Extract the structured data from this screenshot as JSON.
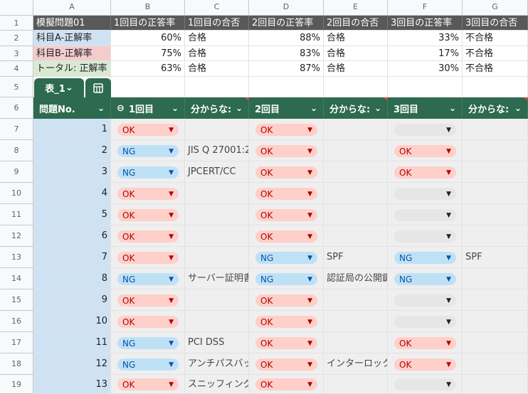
{
  "column_letters": [
    "A",
    "B",
    "C",
    "D",
    "E",
    "F",
    "G"
  ],
  "row_numbers": [
    "1",
    "2",
    "3",
    "4",
    "5",
    "6",
    "7",
    "8",
    "9",
    "10",
    "11",
    "12",
    "13",
    "14",
    "15",
    "16",
    "17",
    "18",
    "19"
  ],
  "summary": {
    "header": [
      "模擬問題01",
      "1回目の正答率",
      "1回目の合否",
      "2回目の正答率",
      "2回目の合否",
      "3回目の正答率",
      "3回目の合否"
    ],
    "rows": [
      [
        "科目A-正解率",
        "60%",
        "合格",
        "88%",
        "合格",
        "33%",
        "不合格"
      ],
      [
        "科目B-正解率",
        "75%",
        "合格",
        "83%",
        "合格",
        "17%",
        "不合格"
      ],
      [
        "トータル: 正解率",
        "63%",
        "合格",
        "87%",
        "合格",
        "30%",
        "不合格"
      ]
    ]
  },
  "table": {
    "tab_name": "表_1",
    "view_icon": "table-view-icon",
    "columns": [
      "問題No.",
      "1回目",
      "分からな:",
      "2回目",
      "分からな:",
      "3回目",
      "分からな:"
    ],
    "rows": [
      {
        "no": "1",
        "r1": "OK",
        "n1": "",
        "r2": "OK",
        "n2": "",
        "r3": "",
        "n3": ""
      },
      {
        "no": "2",
        "r1": "NG",
        "n1": "JIS Q 27001:2",
        "r2": "OK",
        "n2": "",
        "r3": "OK",
        "n3": ""
      },
      {
        "no": "3",
        "r1": "NG",
        "n1": "JPCERT/CC",
        "r2": "OK",
        "n2": "",
        "r3": "OK",
        "n3": ""
      },
      {
        "no": "4",
        "r1": "OK",
        "n1": "",
        "r2": "OK",
        "n2": "",
        "r3": "",
        "n3": ""
      },
      {
        "no": "5",
        "r1": "OK",
        "n1": "",
        "r2": "OK",
        "n2": "",
        "r3": "",
        "n3": ""
      },
      {
        "no": "6",
        "r1": "OK",
        "n1": "",
        "r2": "OK",
        "n2": "",
        "r3": "",
        "n3": ""
      },
      {
        "no": "7",
        "r1": "OK",
        "n1": "",
        "r2": "NG",
        "n2": "SPF",
        "r3": "NG",
        "n3": "SPF"
      },
      {
        "no": "8",
        "r1": "NG",
        "n1": "サーバー証明書",
        "r2": "NG",
        "n2": "認証局の公開鍵",
        "r3": "NG",
        "n3": ""
      },
      {
        "no": "9",
        "r1": "OK",
        "n1": "",
        "r2": "OK",
        "n2": "",
        "r3": "",
        "n3": ""
      },
      {
        "no": "10",
        "r1": "OK",
        "n1": "",
        "r2": "OK",
        "n2": "",
        "r3": "",
        "n3": ""
      },
      {
        "no": "11",
        "r1": "NG",
        "n1": "PCI DSS",
        "r2": "OK",
        "n2": "",
        "r3": "OK",
        "n3": ""
      },
      {
        "no": "12",
        "r1": "NG",
        "n1": "アンチパスバック",
        "r2": "OK",
        "n2": "インターロック",
        "r3": "OK",
        "n3": ""
      },
      {
        "no": "13",
        "r1": "OK",
        "n1": "スニッフィング",
        "r2": "OK",
        "n2": "",
        "r3": "",
        "n3": ""
      }
    ]
  },
  "colors": {
    "ok_pill": "#ffcfc9",
    "ng_pill": "#bfe1f6",
    "table_header": "#2d6a4f",
    "summary_header": "#595959"
  }
}
